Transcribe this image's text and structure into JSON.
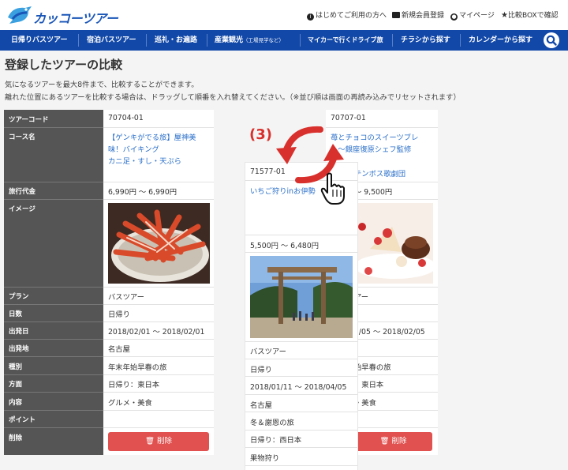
{
  "brand": {
    "logo_text": "カッコーツアー"
  },
  "utility_links": [
    {
      "icon": "info-icon",
      "label": "はじめてご利用の方へ"
    },
    {
      "icon": "member-card-icon",
      "label": "新規会員登録"
    },
    {
      "icon": "user-icon",
      "label": "マイページ"
    },
    {
      "icon": "star-icon",
      "label": "比較BOXで確認"
    }
  ],
  "nav": [
    {
      "label": "日帰りバスツアー"
    },
    {
      "label": "宿泊バスツアー"
    },
    {
      "label": "巡礼・お遍路"
    },
    {
      "label": "産業観光",
      "sub": "（工場見学など）"
    },
    {
      "label": "マイカーで行くドライブ旅"
    },
    {
      "label": "チラシから探す"
    },
    {
      "label": "カレンダーから探す"
    }
  ],
  "page": {
    "title": "登録したツアーの比較",
    "desc1": "気になるツアーを最大8件まで、比較することができます。",
    "desc2": "離れた位置にあるツアーを比較する場合は、ドラッグして順番を入れ替えてください。（※並び順は画面の再読み込みでリセットされます）"
  },
  "labels": {
    "code": "ツアーコード",
    "course": "コース名",
    "price": "旅行代金",
    "image": "イメージ",
    "plan": "プラン",
    "days": "日数",
    "departure": "出発日",
    "origin": "出発地",
    "type": "種別",
    "direction": "方面",
    "content": "内容",
    "point": "ポイント",
    "delete": "削除"
  },
  "tours": [
    {
      "code": "70704-01",
      "course1": "【ゲンキがでる旅】屋神美",
      "course2": "味！バイキング",
      "course3": "カニ足・すし・天ぷら",
      "price": "6,990円 〜 6,990円",
      "plan": "バスツアー",
      "days": "日帰り",
      "departure": "2018/02/01 〜 2018/02/01",
      "origin": "名古屋",
      "type": "年末年始早春の旅",
      "direction": "日帰り：東日本",
      "content": "グルメ・美食",
      "delete_label": "削除"
    },
    {
      "code": "71577-01",
      "course1": "いちご狩りinお伊勢",
      "price": "5,500円 〜 6,480円",
      "plan": "バスツアー",
      "days": "日帰り",
      "departure": "2018/01/11 〜 2018/04/05",
      "origin": "名古屋",
      "type": "冬＆謝恩の旅",
      "direction": "日帰り：西日本",
      "content": "果物狩り"
    },
    {
      "code": "70707-01",
      "course1": "苺とチョコのスイーツブレ",
      "course2": "ト〜銀座復原シェフ監修",
      "course3": "テンボス歌劇団",
      "price_partial": "〜 9,500円",
      "plan_partial": "アー",
      "departure_partial": "2/05 〜 2018/02/05",
      "type_partial": "始早春の旅",
      "direction_partial": "：東日本",
      "content_partial": "・美食",
      "delete_label": "削除"
    }
  ],
  "drag_hint": {
    "step": "(3)"
  },
  "colors": {
    "nav": "#1248a8",
    "label_bg": "#555555",
    "link": "#2a6fc9",
    "delete": "#e0514f",
    "arrow": "#d8302c"
  }
}
